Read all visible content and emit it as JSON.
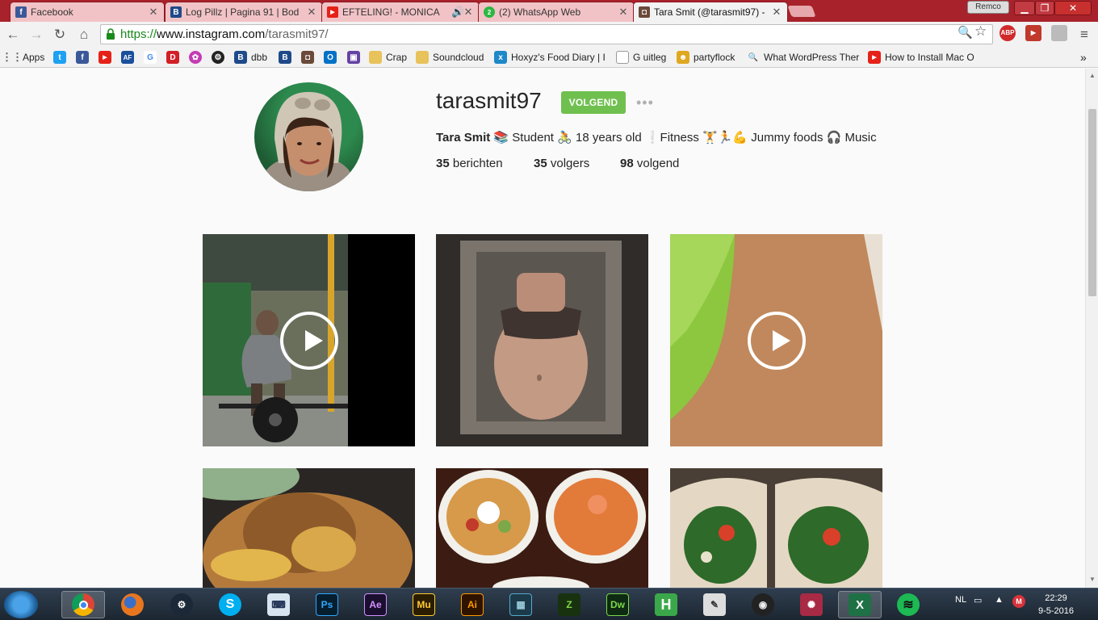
{
  "browser": {
    "tabs": [
      {
        "label": "Facebook",
        "icon": "facebook-icon"
      },
      {
        "label": "Log Pillz | Pagina 91 | Bod",
        "icon": "bodyspace-icon"
      },
      {
        "label": "EFTELING! - MONICA",
        "icon": "youtube-icon"
      },
      {
        "label": "(2) WhatsApp Web",
        "icon": "whatsapp-icon"
      },
      {
        "label": "Tara Smit (@tarasmit97) -",
        "icon": "instagram-icon"
      }
    ],
    "profile_name": "Remco",
    "url_scheme": "https://",
    "url_host": "www.instagram.com",
    "url_path": "/tarasmit97/"
  },
  "bookmarks": {
    "apps_label": "Apps",
    "items": [
      {
        "label": "dbb"
      },
      {
        "label": "Crap"
      },
      {
        "label": "Soundcloud"
      },
      {
        "label": "Hoxyz's Food Diary | I"
      },
      {
        "label": "G uitleg"
      },
      {
        "label": "partyflock"
      },
      {
        "label": "What WordPress Ther"
      },
      {
        "label": "How to Install Mac O"
      }
    ]
  },
  "profile": {
    "username": "tarasmit97",
    "follow_label": "VOLGEND",
    "full_name": "Tara Smit",
    "bio": "📚 Student 🚴 18 years old ❕Fitness 🏋🏃💪 Jummy foods 🎧 Music",
    "posts_count": "35",
    "posts_label": "berichten",
    "followers_count": "35",
    "followers_label": "volgers",
    "following_count": "98",
    "following_label": "volgend"
  },
  "posts": [
    {
      "kind": "video",
      "subject": "gym deadlift"
    },
    {
      "kind": "photo",
      "subject": "mirror selfie"
    },
    {
      "kind": "video",
      "subject": "arm on green"
    },
    {
      "kind": "photo",
      "subject": "food plate"
    },
    {
      "kind": "photo",
      "subject": "nachos and pasta"
    },
    {
      "kind": "photo",
      "subject": "wraps"
    }
  ],
  "taskbar": {
    "language": "NL",
    "time": "22:29",
    "date": "9-5-2016",
    "apps": [
      "Chrome",
      "Firefox",
      "Steam",
      "Skype",
      "Keyboard",
      "Photoshop",
      "After Effects",
      "Muse",
      "Illustrator",
      "Video",
      "FL Studio",
      "Dreamweaver",
      "Hoxyz",
      "Notebook",
      "Racing",
      "Game",
      "Excel",
      "Spotify"
    ]
  }
}
